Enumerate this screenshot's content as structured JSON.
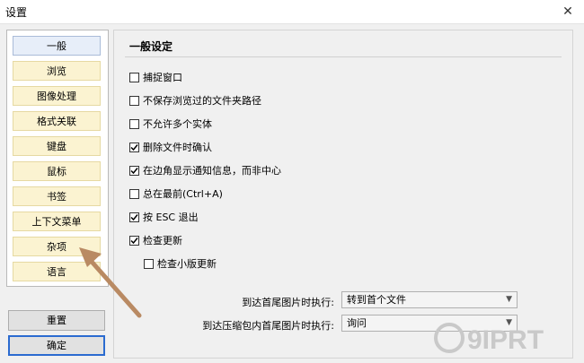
{
  "window": {
    "title": "设置"
  },
  "sidebar": {
    "items": [
      {
        "label": "一般"
      },
      {
        "label": "浏览"
      },
      {
        "label": "图像处理"
      },
      {
        "label": "格式关联"
      },
      {
        "label": "键盘"
      },
      {
        "label": "鼠标"
      },
      {
        "label": "书签"
      },
      {
        "label": "上下文菜单"
      },
      {
        "label": "杂项"
      },
      {
        "label": "语言"
      }
    ]
  },
  "buttons": {
    "reset": "重置",
    "ok": "确定"
  },
  "general": {
    "title": "一般设定",
    "options": [
      {
        "label": "捕捉窗口",
        "checked": false
      },
      {
        "label": "不保存浏览过的文件夹路径",
        "checked": false
      },
      {
        "label": "不允许多个实体",
        "checked": false
      },
      {
        "label": "删除文件时确认",
        "checked": true
      },
      {
        "label": "在边角显示通知信息，而非中心",
        "checked": true
      },
      {
        "label": "总在最前(Ctrl+A)",
        "checked": false
      },
      {
        "label": "按 ESC 退出",
        "checked": true
      },
      {
        "label": "检查更新",
        "checked": true
      },
      {
        "label": "检查小版更新",
        "checked": false
      }
    ],
    "end_of_folder": {
      "label": "到达首尾图片时执行:",
      "value": "转到首个文件"
    },
    "end_of_archive": {
      "label": "到达压缩包内首尾图片时执行:",
      "value": "询问"
    }
  },
  "watermark": {
    "text": "9IPRT"
  },
  "colors": {
    "nav_bg": "#fbf3d1",
    "active_nav_bg": "#e7eef9",
    "arrow": "#b98a63",
    "primary_border": "#2b6bd0"
  }
}
